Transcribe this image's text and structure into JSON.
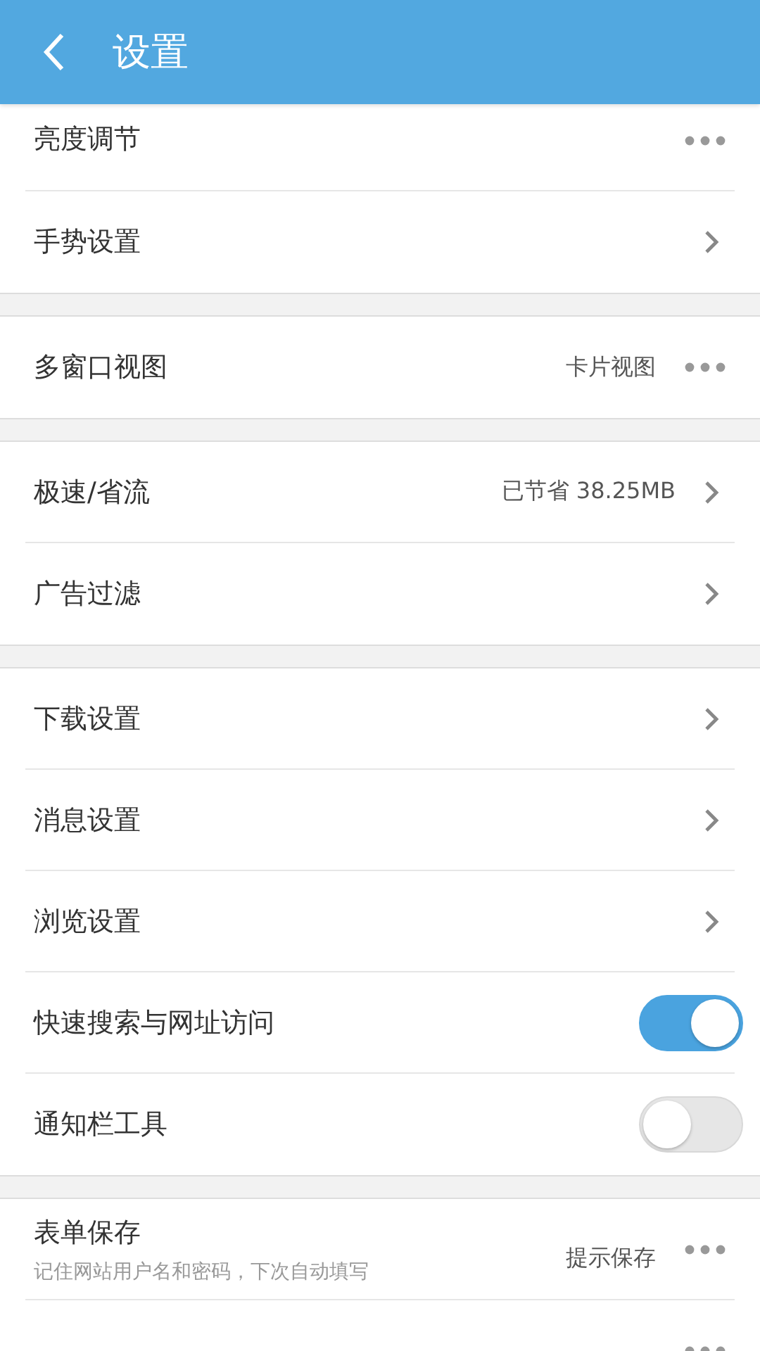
{
  "header": {
    "title": "设置"
  },
  "groups": [
    {
      "items": [
        {
          "label": "亮度调节",
          "kind": "more"
        },
        {
          "label": "手势设置",
          "kind": "link"
        }
      ]
    },
    {
      "items": [
        {
          "label": "多窗口视图",
          "value": "卡片视图",
          "kind": "more"
        }
      ]
    },
    {
      "items": [
        {
          "label": "极速/省流",
          "value": "已节省 38.25MB",
          "kind": "link"
        },
        {
          "label": "广告过滤",
          "kind": "link"
        }
      ]
    },
    {
      "items": [
        {
          "label": "下载设置",
          "kind": "link"
        },
        {
          "label": "消息设置",
          "kind": "link"
        },
        {
          "label": "浏览设置",
          "kind": "link"
        },
        {
          "label": "快速搜索与网址访问",
          "kind": "toggle",
          "on": true
        },
        {
          "label": "通知栏工具",
          "kind": "toggle",
          "on": false
        }
      ]
    },
    {
      "items": [
        {
          "label": "表单保存",
          "subtitle": "记住网站用户名和密码，下次自动填写",
          "value": "提示保存",
          "kind": "more"
        },
        {
          "kind": "more"
        }
      ]
    }
  ]
}
